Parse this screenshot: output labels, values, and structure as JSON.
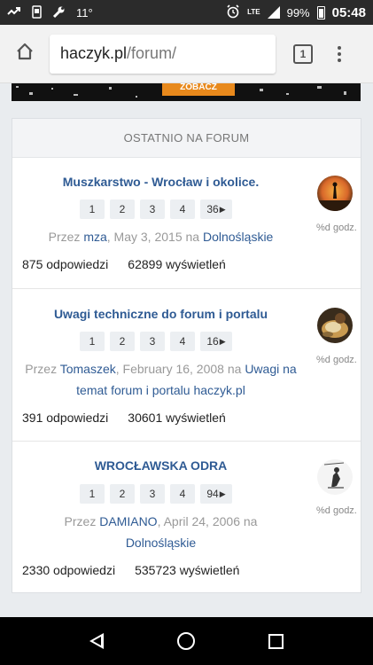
{
  "statusbar": {
    "temperature": "11°",
    "network": "LTE",
    "battery": "99%",
    "time": "05:48"
  },
  "browser": {
    "url_host": "haczyk.pl",
    "url_path": "/forum/",
    "tab_count": "1"
  },
  "banner": {
    "button_text": "ZOBACZ"
  },
  "forum": {
    "header": "OSTATNIO NA FORUM",
    "topics": [
      {
        "title": "Muszkarstwo - Wrocław i okolice.",
        "pages": [
          "1",
          "2",
          "3",
          "4",
          "36"
        ],
        "prefix": "Przez ",
        "author": "mza",
        "date": ", May 3, 2015 na ",
        "category": "Dolnośląskie",
        "replies": "875 odpowiedzi",
        "views": "62899 wyświetleń",
        "ago": "%d godz."
      },
      {
        "title": "Uwagi techniczne do forum i portalu",
        "pages": [
          "1",
          "2",
          "3",
          "4",
          "16"
        ],
        "prefix": "Przez ",
        "author": "Tomaszek",
        "date": ", February 16, 2008 na ",
        "category": "Uwagi na temat forum i portalu haczyk.pl",
        "replies": "391 odpowiedzi",
        "views": "30601 wyświetleń",
        "ago": "%d godz."
      },
      {
        "title": "WROCŁAWSKA ODRA",
        "pages": [
          "1",
          "2",
          "3",
          "4",
          "94"
        ],
        "prefix": "Przez ",
        "author": "DAMIANO",
        "date": ", April 24, 2006 na ",
        "category": "Dolnośląskie",
        "replies": "2330 odpowiedzi",
        "views": "535723 wyświetleń",
        "ago": "%d godz."
      }
    ]
  },
  "icons": {
    "statusbar": [
      "missed-call-icon",
      "phone-icon",
      "wrench-icon",
      "alarm-icon",
      "signal-icon",
      "battery-icon"
    ],
    "browser": [
      "home-icon",
      "tab-switcher-icon",
      "overflow-menu-icon"
    ],
    "navbar": [
      "back-icon",
      "home-icon",
      "recents-icon"
    ]
  }
}
